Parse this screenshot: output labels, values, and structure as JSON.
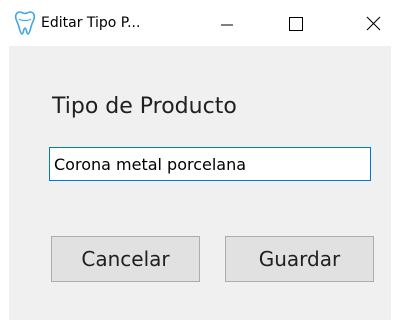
{
  "window": {
    "title": "Editar Tipo P...",
    "app_icon": "tooth-icon",
    "controls": {
      "minimize_icon": "minimize-icon",
      "maximize_icon": "maximize-icon",
      "close_icon": "close-icon"
    }
  },
  "form": {
    "heading": "Tipo de Producto",
    "input_value": "Corona metal porcelana",
    "cancel_label": "Cancelar",
    "save_label": "Guardar"
  },
  "colors": {
    "client_background": "#f0f0f0",
    "input_focus_border": "#0078d7",
    "button_background": "#e1e1e1",
    "icon_accent": "#3fa9e0"
  }
}
